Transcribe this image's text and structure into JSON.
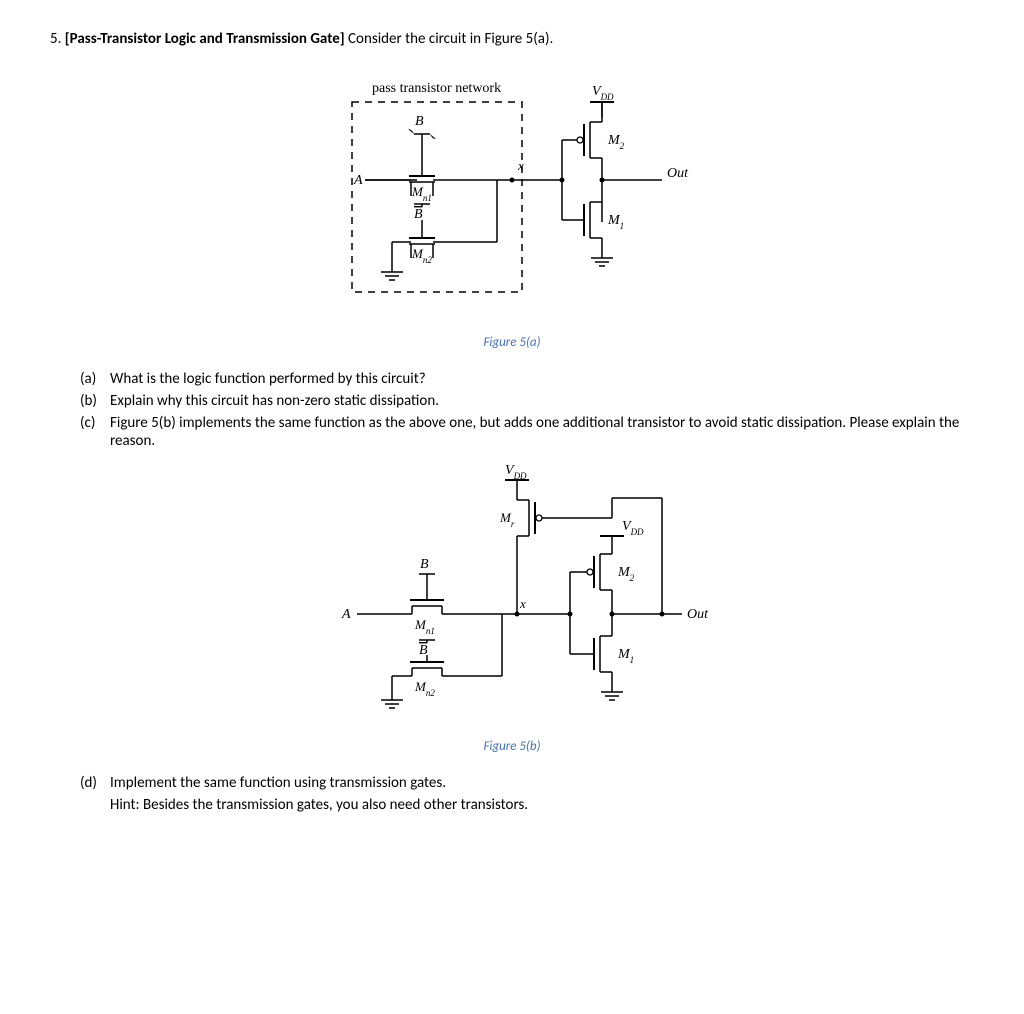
{
  "problem": {
    "number": "5",
    "title": "[Pass-Transistor Logic and Transmission Gate]",
    "stem_rest": " Consider the circuit in Figure 5(a)."
  },
  "fig_a": {
    "box_label": "pass transistor network",
    "caption": "Figure 5(a)",
    "labels": {
      "vdd": "V_DD",
      "A": "A",
      "B": "B",
      "Bbar": "B̄",
      "Mn1": "M_n1",
      "Mn2": "M_n2",
      "x": "x",
      "M1": "M₁",
      "M2": "M₂",
      "Out": "Out"
    }
  },
  "fig_b": {
    "caption": "Figure 5(b)",
    "labels": {
      "vdd1": "V_DD",
      "vdd2": "V_DD",
      "A": "A",
      "B": "B",
      "Bbar": "B̄",
      "Mn1": "M_n1",
      "Mn2": "M_n2",
      "Mr": "M_r",
      "x": "x",
      "M1": "M₁",
      "M2": "M₂",
      "Out": "Out"
    }
  },
  "parts": {
    "a": "What is the logic function performed by this circuit?",
    "b": "Explain why this circuit has non-zero static dissipation.",
    "c": "Figure 5(b) implements the same function as the above one, but adds one additional transistor to avoid static dissipation. Please explain the reason.",
    "d": "Implement the same function using transmission gates.",
    "d_hint": "Hint: Besides the transmission gates, you also need other transistors."
  },
  "chart_data": {
    "type": "circuit-diagram",
    "figures": [
      {
        "name": "Figure 5(a)",
        "description": "Pass-transistor network (Mn1 gated by B passes A, Mn2 gated by B̄ passes GND) driving node x into a CMOS inverter (PMOS M2 to V_DD, NMOS M1 to GND) producing Out."
      },
      {
        "name": "Figure 5(b)",
        "description": "Same as 5(a) plus level-restoring PMOS Mr from V_DD to node x, gate driven by Out."
      }
    ]
  }
}
